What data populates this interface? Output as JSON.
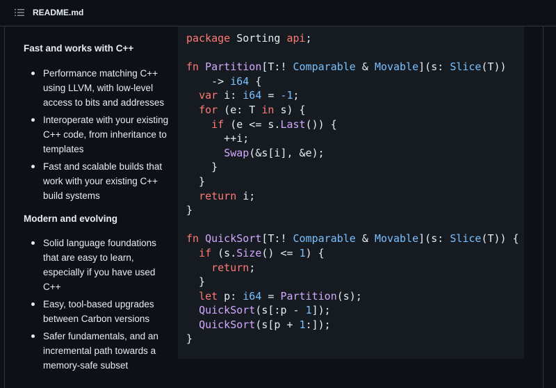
{
  "header": {
    "file_name": "README.md",
    "toc_icon": "list-unordered-icon"
  },
  "sections": [
    {
      "title": "Fast and works with C++",
      "bullets": [
        "Performance matching C++ using LLVM, with low-level access to bits and addresses",
        "Interoperate with your existing C++ code, from inheritance to templates",
        "Fast and scalable builds that work with your existing C++ build systems"
      ]
    },
    {
      "title": "Modern and evolving",
      "bullets": [
        "Solid language foundations that are easy to learn, especially if you have used C++",
        "Easy, tool-based upgrades between Carbon versions",
        "Safer fundamentals, and an incremental path towards a memory-safe subset"
      ]
    }
  ],
  "code": {
    "lines": [
      [
        [
          "kw",
          "package"
        ],
        [
          "t",
          " Sorting "
        ],
        [
          "kw",
          "api"
        ],
        [
          "t",
          ";"
        ]
      ],
      [],
      [
        [
          "kw",
          "fn"
        ],
        [
          "t",
          " "
        ],
        [
          "fn",
          "Partition"
        ],
        [
          "t",
          "[T:! "
        ],
        [
          "ty",
          "Comparable"
        ],
        [
          "t",
          " & "
        ],
        [
          "ty",
          "Movable"
        ],
        [
          "t",
          "](s: "
        ],
        [
          "ty",
          "Slice"
        ],
        [
          "t",
          "(T))"
        ]
      ],
      [
        [
          "t",
          "    -> "
        ],
        [
          "ty",
          "i64"
        ],
        [
          "t",
          " {"
        ]
      ],
      [
        [
          "t",
          "  "
        ],
        [
          "kw",
          "var"
        ],
        [
          "t",
          " i: "
        ],
        [
          "ty",
          "i64"
        ],
        [
          "t",
          " = "
        ],
        [
          "nm",
          "-1"
        ],
        [
          "t",
          ";"
        ]
      ],
      [
        [
          "t",
          "  "
        ],
        [
          "kw",
          "for"
        ],
        [
          "t",
          " (e: T "
        ],
        [
          "kw",
          "in"
        ],
        [
          "t",
          " s) {"
        ]
      ],
      [
        [
          "t",
          "    "
        ],
        [
          "kw",
          "if"
        ],
        [
          "t",
          " (e <= s."
        ],
        [
          "fn",
          "Last"
        ],
        [
          "t",
          "()) {"
        ]
      ],
      [
        [
          "t",
          "      ++i;"
        ]
      ],
      [
        [
          "t",
          "      "
        ],
        [
          "fn",
          "Swap"
        ],
        [
          "t",
          "(&s[i], &e);"
        ]
      ],
      [
        [
          "t",
          "    }"
        ]
      ],
      [
        [
          "t",
          "  }"
        ]
      ],
      [
        [
          "t",
          "  "
        ],
        [
          "kw",
          "return"
        ],
        [
          "t",
          " i;"
        ]
      ],
      [
        [
          "t",
          "}"
        ]
      ],
      [],
      [
        [
          "kw",
          "fn"
        ],
        [
          "t",
          " "
        ],
        [
          "fn",
          "QuickSort"
        ],
        [
          "t",
          "[T:! "
        ],
        [
          "ty",
          "Comparable"
        ],
        [
          "t",
          " & "
        ],
        [
          "ty",
          "Movable"
        ],
        [
          "t",
          "](s: "
        ],
        [
          "ty",
          "Slice"
        ],
        [
          "t",
          "(T)) {"
        ]
      ],
      [
        [
          "t",
          "  "
        ],
        [
          "kw",
          "if"
        ],
        [
          "t",
          " (s."
        ],
        [
          "fn",
          "Size"
        ],
        [
          "t",
          "() <= "
        ],
        [
          "nm",
          "1"
        ],
        [
          "t",
          ") {"
        ]
      ],
      [
        [
          "t",
          "    "
        ],
        [
          "kw",
          "return"
        ],
        [
          "t",
          ";"
        ]
      ],
      [
        [
          "t",
          "  }"
        ]
      ],
      [
        [
          "t",
          "  "
        ],
        [
          "kw",
          "let"
        ],
        [
          "t",
          " p: "
        ],
        [
          "ty",
          "i64"
        ],
        [
          "t",
          " = "
        ],
        [
          "fn",
          "Partition"
        ],
        [
          "t",
          "(s);"
        ]
      ],
      [
        [
          "t",
          "  "
        ],
        [
          "fn",
          "QuickSort"
        ],
        [
          "t",
          "(s[:p - "
        ],
        [
          "nm",
          "1"
        ],
        [
          "t",
          "]);"
        ]
      ],
      [
        [
          "t",
          "  "
        ],
        [
          "fn",
          "QuickSort"
        ],
        [
          "t",
          "(s[p + "
        ],
        [
          "nm",
          "1"
        ],
        [
          "t",
          ":]);"
        ]
      ],
      [
        [
          "t",
          "}"
        ]
      ]
    ]
  }
}
